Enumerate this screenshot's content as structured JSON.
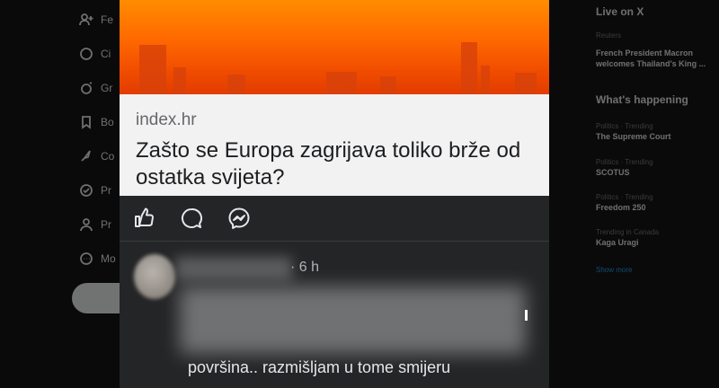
{
  "background": {
    "left_nav": [
      "Fe",
      "Ci",
      "Gr",
      "Bo",
      "Co",
      "Pr",
      "Pr",
      "Mo"
    ],
    "right_col": {
      "live_heading": "Live on X",
      "live_source": "Reuters",
      "live_title": "French President Macron welcomes Thailand's King ...",
      "happening_heading": "What's happening",
      "trends": [
        {
          "meta": "Politics · Trending",
          "name": "The Supreme Court"
        },
        {
          "meta": "Politics · Trending",
          "name": "SCOTUS"
        },
        {
          "meta": "Politics · Trending",
          "name": "Freedom 250"
        },
        {
          "meta": "Trending in Canada",
          "name": "Kaga Uragi"
        }
      ],
      "show_more": "Show more"
    }
  },
  "post": {
    "link": {
      "domain": "index.hr",
      "headline": "Zašto se Europa zagrijava toliko brže od ostatka svijeta?"
    },
    "actions": [
      "like-icon",
      "comment-icon",
      "messenger-icon"
    ],
    "comment": {
      "timestamp": "· 6 h",
      "visible_text": "površina.. razmišljam u tome smijeru"
    }
  },
  "colors": {
    "banner_top": "#ff8c00",
    "banner_bottom": "#e23c00",
    "card_bg": "#f2f2f2",
    "dark_bg": "#242526"
  }
}
